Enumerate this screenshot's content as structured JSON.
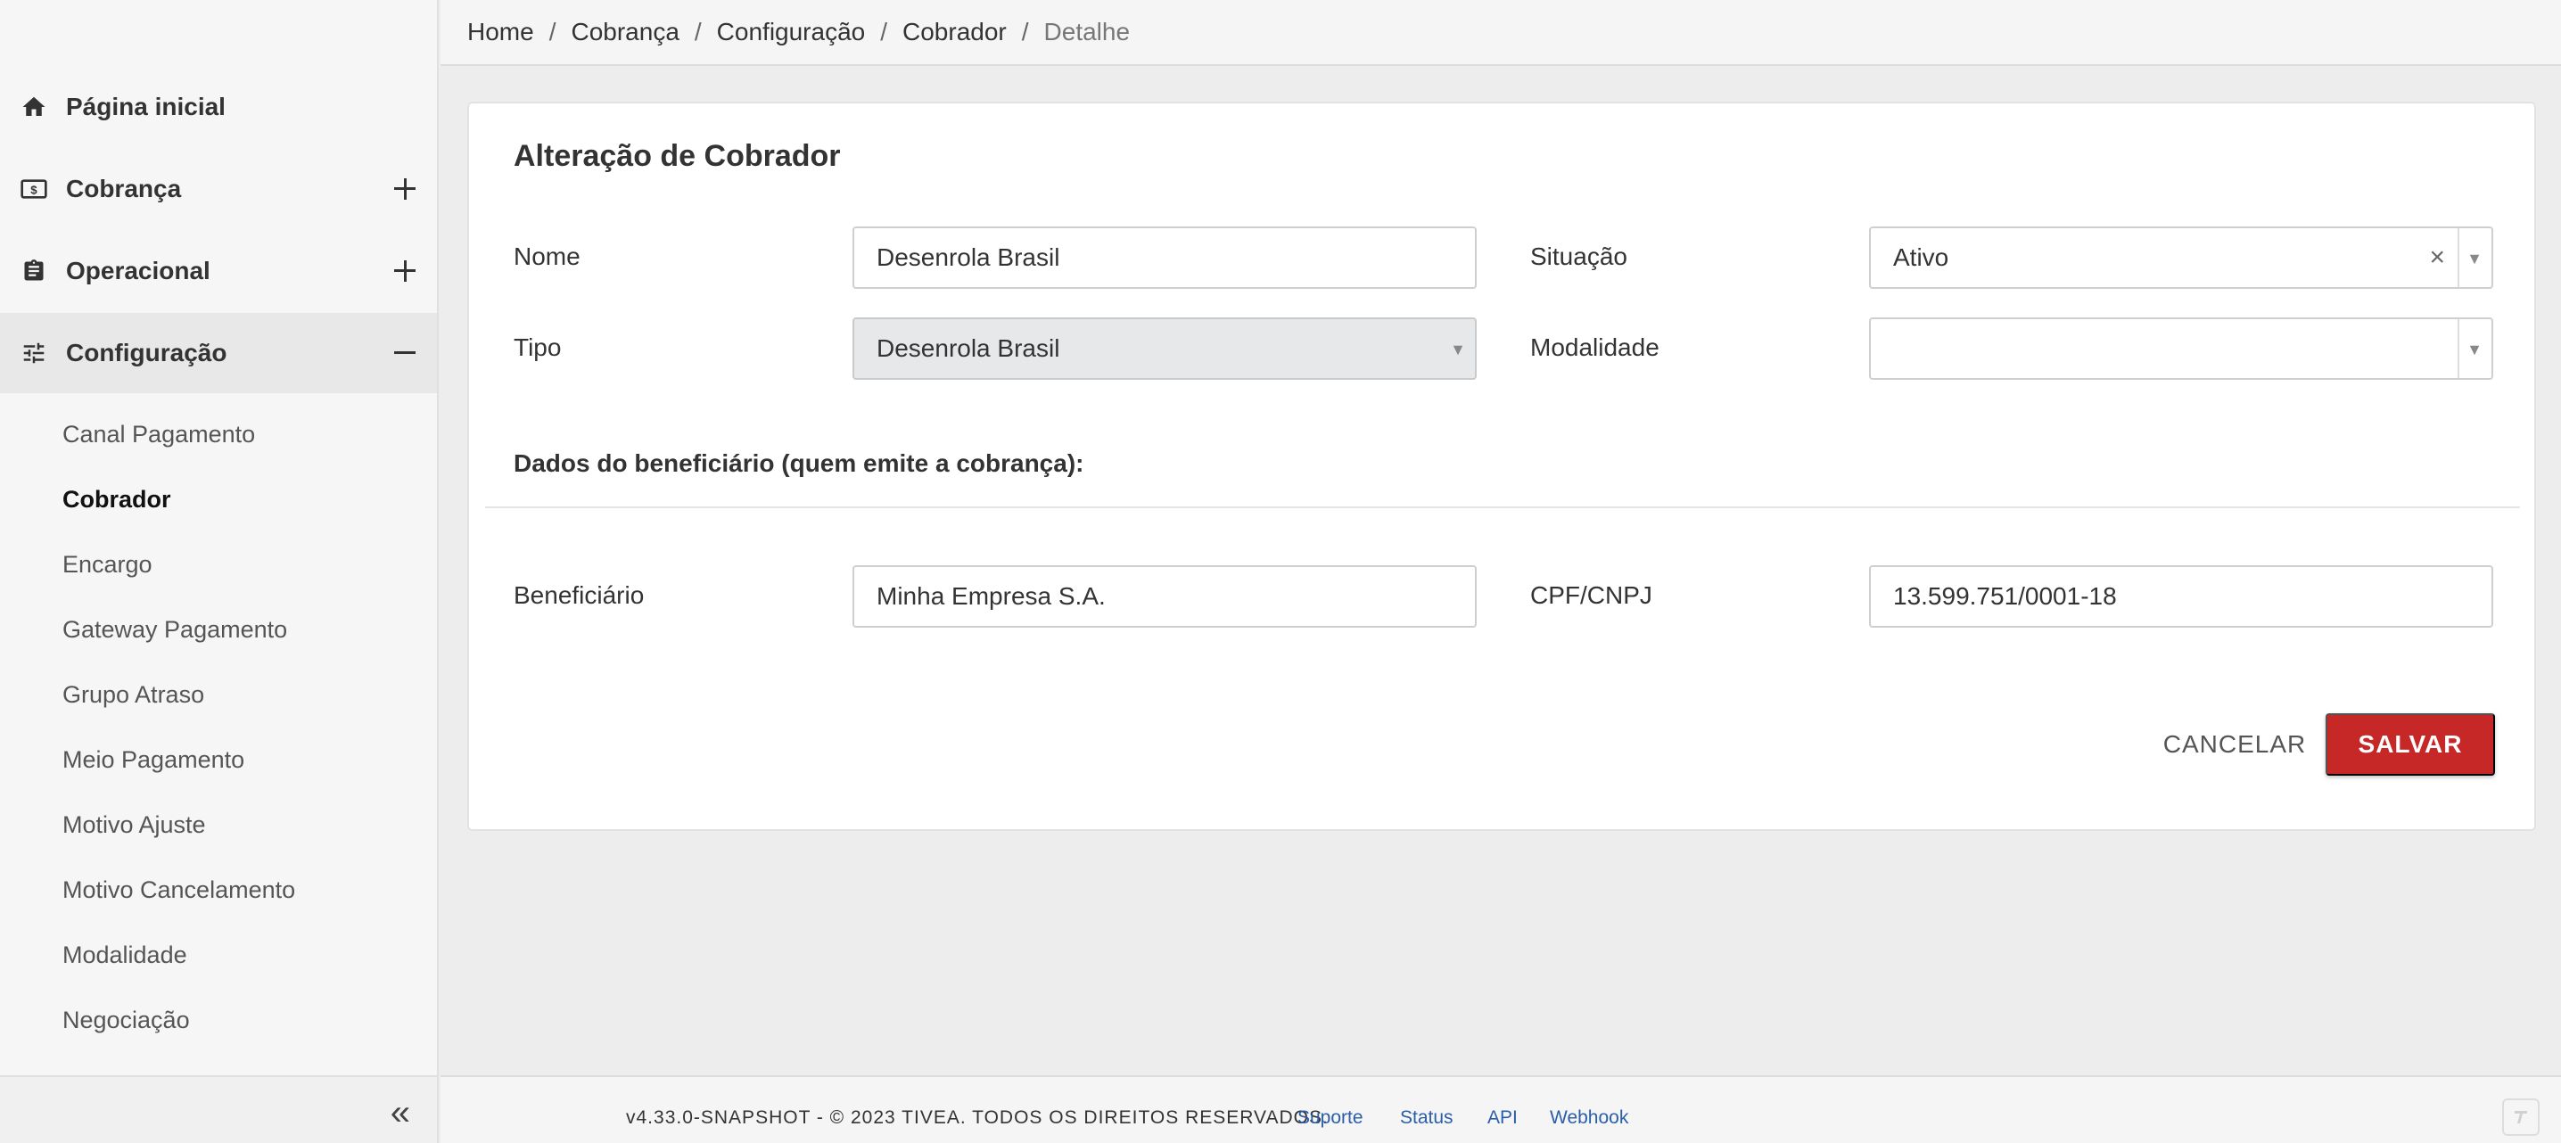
{
  "breadcrumb": {
    "items": [
      "Home",
      "Cobrança",
      "Configuração",
      "Cobrador",
      "Detalhe"
    ],
    "separator": "/"
  },
  "sidebar": {
    "items": [
      {
        "label": "Página inicial",
        "icon": "home-icon"
      },
      {
        "label": "Cobrança",
        "icon": "money-icon",
        "toggle": "+"
      },
      {
        "label": "Operacional",
        "icon": "clipboard-icon",
        "toggle": "+"
      },
      {
        "label": "Configuração",
        "icon": "sliders-icon",
        "toggle": "−"
      }
    ],
    "subitems": [
      "Canal Pagamento",
      "Cobrador",
      "Encargo",
      "Gateway Pagamento",
      "Grupo Atraso",
      "Meio Pagamento",
      "Motivo Ajuste",
      "Motivo Cancelamento",
      "Modalidade",
      "Negociação"
    ],
    "current_subitem": "Cobrador",
    "collapse_icon": "double-chevron-left-icon",
    "collapse_glyph": "«"
  },
  "form": {
    "title": "Alteração de Cobrador",
    "nome_label": "Nome",
    "nome_value": "Desenrola Brasil",
    "situacao_label": "Situação",
    "situacao_value": "Ativo",
    "tipo_label": "Tipo",
    "tipo_value": "Desenrola Brasil",
    "modalidade_label": "Modalidade",
    "modalidade_value": "",
    "section_title": "Dados do beneficiário (quem emite a cobrança):",
    "beneficiario_label": "Beneficiário",
    "beneficiario_value": "Minha Empresa S.A.",
    "cpf_label": "CPF/CNPJ",
    "cpf_value": "13.599.751/0001-18",
    "cancel_label": "CANCELAR",
    "save_label": "SALVAR"
  },
  "footer": {
    "copyright": "v4.33.0-SNAPSHOT - © 2023 TIVEA. TODOS OS DIREITOS RESERVADOS.",
    "links": [
      "Suporte",
      "Status",
      "API",
      "Webhook"
    ]
  },
  "colors": {
    "primary": "#c62828",
    "link": "#2a5ea8"
  }
}
